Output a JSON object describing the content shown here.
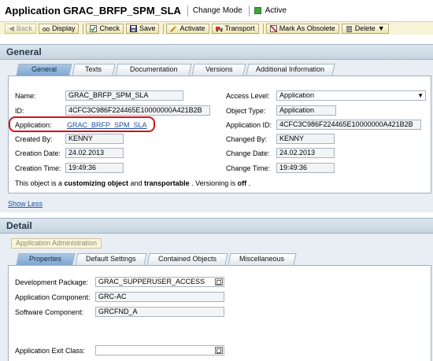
{
  "header": {
    "title": "Application GRAC_BRFP_SPM_SLA",
    "mode": "Change Mode",
    "status": "Active"
  },
  "toolbar": {
    "back": "Back",
    "display": "Display",
    "check": "Check",
    "save": "Save",
    "activate": "Activate",
    "transport": "Transport",
    "mark_obsolete": "Mark As Obsolete",
    "delete": "Delete"
  },
  "general": {
    "section_title": "General",
    "tabs": [
      "General",
      "Texts",
      "Documentation",
      "Versions",
      "Additional Information"
    ],
    "name_label": "Name:",
    "name_value": "GRAC_BRFP_SPM_SLA",
    "id_label": "ID:",
    "id_value": "4CFC3C986F224465E10000000A421B2B",
    "application_label": "Application:",
    "application_value": "GRAC_BRFP_SPM_SLA",
    "created_by_label": "Created By:",
    "created_by_value": "KENNY",
    "creation_date_label": "Creation Date:",
    "creation_date_value": "24.02.2013",
    "creation_time_label": "Creation Time:",
    "creation_time_value": "19:49:36",
    "access_level_label": "Access Level:",
    "access_level_value": "Application",
    "object_type_label": "Object Type:",
    "object_type_value": "Application",
    "application_id_label": "Application ID:",
    "application_id_value": "4CFC3C986F224465E10000000A421B2B",
    "changed_by_label": "Changed By:",
    "changed_by_value": "KENNY",
    "change_date_label": "Change Date:",
    "change_date_value": "24.02.2013",
    "change_time_label": "Change Time:",
    "change_time_value": "19:49:36",
    "note_prefix": "This object is a ",
    "note_bold1": "customizing object",
    "note_mid": " and ",
    "note_bold2": "transportable",
    "note_suffix1": " . Versioning is ",
    "note_bold3": "off",
    "note_suffix2": " .",
    "show_less": "Show Less"
  },
  "detail": {
    "section_title": "Detail",
    "app_admin": "Application Administration",
    "tabs": [
      "Properties",
      "Default Settings",
      "Contained Objects",
      "Miscellaneous"
    ],
    "dev_package_label": "Development Package:",
    "dev_package_value": "GRAC_SUPPERUSER_ACCESS",
    "app_component_label": "Application Component:",
    "app_component_value": "GRC-AC",
    "sw_component_label": "Software Component:",
    "sw_component_value": "GRCFND_A",
    "exit_class_label": "Application Exit Class:",
    "exit_class_value": ""
  },
  "colors": {
    "accent_red": "#d4101a",
    "status_green": "#3fa63a",
    "section_bg": "#e8eef3",
    "active_tab": "#7fa7d0"
  }
}
